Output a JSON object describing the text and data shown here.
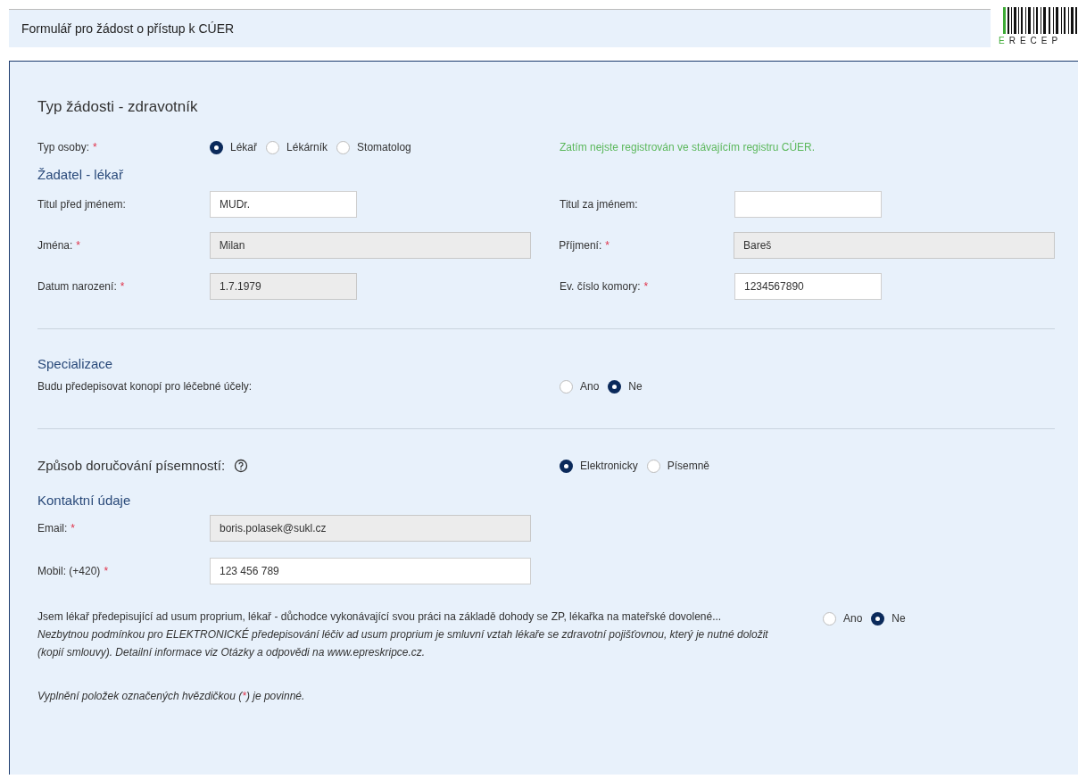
{
  "header": {
    "title": "Formulář pro žádost o přístup k CÚER",
    "logo_text": "ERECEP"
  },
  "form_title": "Typ žádosti - zdravotník",
  "person_type": {
    "label": "Typ osoby:",
    "required": true,
    "options": [
      {
        "label": "Lékař",
        "selected": true
      },
      {
        "label": "Lékárník",
        "selected": false
      },
      {
        "label": "Stomatolog",
        "selected": false
      }
    ],
    "notice": "Zatím nejste registrován ve stávajícím registru CÚER."
  },
  "applicant": {
    "title": "Žadatel - lékař",
    "rows": [
      {
        "left": {
          "label": "Titul před jménem:",
          "required": false,
          "value": "MUDr.",
          "readonly": false,
          "kind": "short"
        },
        "right": {
          "label": "Titul za jménem:",
          "required": false,
          "readonly": false,
          "kind": "short"
        }
      },
      {
        "left": {
          "label": "Jména:",
          "required": true,
          "value": "Milan",
          "readonly": true,
          "kind": "long"
        },
        "right": {
          "label": "Příjmení:",
          "required": true,
          "value": "Bareš",
          "readonly": true,
          "kind": "long"
        }
      },
      {
        "left": {
          "label": "Datum narození:",
          "required": true,
          "value": "1.7.1979",
          "readonly": true,
          "kind": "short"
        },
        "right": {
          "label": "Ev. číslo komory:",
          "required": true,
          "value": "1234567890",
          "readonly": false,
          "kind": "short"
        }
      }
    ]
  },
  "specialization": {
    "title": "Specializace",
    "question": "Budu předepisovat konopí pro léčebné účely:",
    "options": [
      {
        "label": "Ano",
        "selected": false
      },
      {
        "label": "Ne",
        "selected": true
      }
    ]
  },
  "delivery": {
    "label": "Způsob doručování písemností:",
    "options": [
      {
        "label": "Elektronicky",
        "selected": true
      },
      {
        "label": "Písemně",
        "selected": false
      }
    ]
  },
  "contact": {
    "title": "Kontaktní údaje",
    "fields": [
      {
        "label": "Email:",
        "required": true,
        "value": "boris.polasek@sukl.cz",
        "readonly": true,
        "kind": "long"
      },
      {
        "label": "Mobil: (+420)",
        "required": true,
        "value": "123 456 789",
        "readonly": false,
        "kind": "long"
      }
    ]
  },
  "ad_usum": {
    "question": "Jsem lékař předepisující ad usum proprium, lékař - důchodce vykonávající svou práci na základě dohody se ZP, lékařka na mateřské dovolené...",
    "note": "Nezbytnou podmínkou pro ELEKTRONICKÉ předepisování léčiv ad usum proprium je smluvní vztah lékaře se zdravotní pojišťovnou, který je nutné doložit (kopií smlouvy). Detailní informace viz Otázky a odpovědi na www.epreskripce.cz.",
    "options": [
      {
        "label": "Ano",
        "selected": false
      },
      {
        "label": "Ne",
        "selected": true
      }
    ]
  },
  "footer": {
    "before": "Vyplnění položek označených hvězdičkou (",
    "mark": "*",
    "after": ") je povinné."
  }
}
